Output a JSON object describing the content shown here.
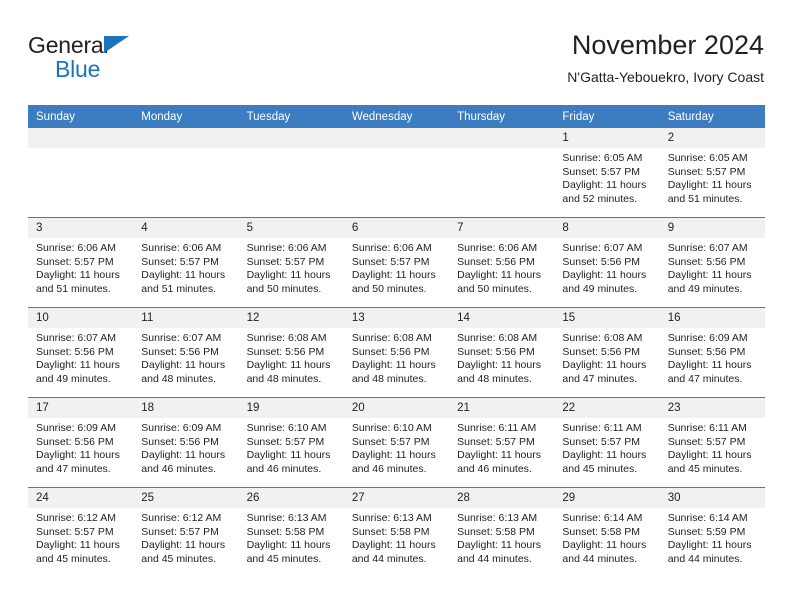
{
  "brand": {
    "name_top": "General",
    "name_bottom": "Blue",
    "flag_color": "#1b75bb"
  },
  "header": {
    "title": "November 2024",
    "subtitle": "N'Gatta-Yebouekro, Ivory Coast"
  },
  "theme": {
    "header_blue": "#3b7dc0",
    "daynum_bg": "#f1f1f1",
    "text": "#231f20"
  },
  "weekday_headers": [
    "Sunday",
    "Monday",
    "Tuesday",
    "Wednesday",
    "Thursday",
    "Friday",
    "Saturday"
  ],
  "weeks": [
    [
      {
        "day": "",
        "sunrise": "",
        "sunset": "",
        "daylight_1": "",
        "daylight_2": "",
        "empty": true
      },
      {
        "day": "",
        "sunrise": "",
        "sunset": "",
        "daylight_1": "",
        "daylight_2": "",
        "empty": true
      },
      {
        "day": "",
        "sunrise": "",
        "sunset": "",
        "daylight_1": "",
        "daylight_2": "",
        "empty": true
      },
      {
        "day": "",
        "sunrise": "",
        "sunset": "",
        "daylight_1": "",
        "daylight_2": "",
        "empty": true
      },
      {
        "day": "",
        "sunrise": "",
        "sunset": "",
        "daylight_1": "",
        "daylight_2": "",
        "empty": true
      },
      {
        "day": "1",
        "sunrise": "Sunrise: 6:05 AM",
        "sunset": "Sunset: 5:57 PM",
        "daylight_1": "Daylight: 11 hours",
        "daylight_2": "and 52 minutes."
      },
      {
        "day": "2",
        "sunrise": "Sunrise: 6:05 AM",
        "sunset": "Sunset: 5:57 PM",
        "daylight_1": "Daylight: 11 hours",
        "daylight_2": "and 51 minutes."
      }
    ],
    [
      {
        "day": "3",
        "sunrise": "Sunrise: 6:06 AM",
        "sunset": "Sunset: 5:57 PM",
        "daylight_1": "Daylight: 11 hours",
        "daylight_2": "and 51 minutes."
      },
      {
        "day": "4",
        "sunrise": "Sunrise: 6:06 AM",
        "sunset": "Sunset: 5:57 PM",
        "daylight_1": "Daylight: 11 hours",
        "daylight_2": "and 51 minutes."
      },
      {
        "day": "5",
        "sunrise": "Sunrise: 6:06 AM",
        "sunset": "Sunset: 5:57 PM",
        "daylight_1": "Daylight: 11 hours",
        "daylight_2": "and 50 minutes."
      },
      {
        "day": "6",
        "sunrise": "Sunrise: 6:06 AM",
        "sunset": "Sunset: 5:57 PM",
        "daylight_1": "Daylight: 11 hours",
        "daylight_2": "and 50 minutes."
      },
      {
        "day": "7",
        "sunrise": "Sunrise: 6:06 AM",
        "sunset": "Sunset: 5:56 PM",
        "daylight_1": "Daylight: 11 hours",
        "daylight_2": "and 50 minutes."
      },
      {
        "day": "8",
        "sunrise": "Sunrise: 6:07 AM",
        "sunset": "Sunset: 5:56 PM",
        "daylight_1": "Daylight: 11 hours",
        "daylight_2": "and 49 minutes."
      },
      {
        "day": "9",
        "sunrise": "Sunrise: 6:07 AM",
        "sunset": "Sunset: 5:56 PM",
        "daylight_1": "Daylight: 11 hours",
        "daylight_2": "and 49 minutes."
      }
    ],
    [
      {
        "day": "10",
        "sunrise": "Sunrise: 6:07 AM",
        "sunset": "Sunset: 5:56 PM",
        "daylight_1": "Daylight: 11 hours",
        "daylight_2": "and 49 minutes."
      },
      {
        "day": "11",
        "sunrise": "Sunrise: 6:07 AM",
        "sunset": "Sunset: 5:56 PM",
        "daylight_1": "Daylight: 11 hours",
        "daylight_2": "and 48 minutes."
      },
      {
        "day": "12",
        "sunrise": "Sunrise: 6:08 AM",
        "sunset": "Sunset: 5:56 PM",
        "daylight_1": "Daylight: 11 hours",
        "daylight_2": "and 48 minutes."
      },
      {
        "day": "13",
        "sunrise": "Sunrise: 6:08 AM",
        "sunset": "Sunset: 5:56 PM",
        "daylight_1": "Daylight: 11 hours",
        "daylight_2": "and 48 minutes."
      },
      {
        "day": "14",
        "sunrise": "Sunrise: 6:08 AM",
        "sunset": "Sunset: 5:56 PM",
        "daylight_1": "Daylight: 11 hours",
        "daylight_2": "and 48 minutes."
      },
      {
        "day": "15",
        "sunrise": "Sunrise: 6:08 AM",
        "sunset": "Sunset: 5:56 PM",
        "daylight_1": "Daylight: 11 hours",
        "daylight_2": "and 47 minutes."
      },
      {
        "day": "16",
        "sunrise": "Sunrise: 6:09 AM",
        "sunset": "Sunset: 5:56 PM",
        "daylight_1": "Daylight: 11 hours",
        "daylight_2": "and 47 minutes."
      }
    ],
    [
      {
        "day": "17",
        "sunrise": "Sunrise: 6:09 AM",
        "sunset": "Sunset: 5:56 PM",
        "daylight_1": "Daylight: 11 hours",
        "daylight_2": "and 47 minutes."
      },
      {
        "day": "18",
        "sunrise": "Sunrise: 6:09 AM",
        "sunset": "Sunset: 5:56 PM",
        "daylight_1": "Daylight: 11 hours",
        "daylight_2": "and 46 minutes."
      },
      {
        "day": "19",
        "sunrise": "Sunrise: 6:10 AM",
        "sunset": "Sunset: 5:57 PM",
        "daylight_1": "Daylight: 11 hours",
        "daylight_2": "and 46 minutes."
      },
      {
        "day": "20",
        "sunrise": "Sunrise: 6:10 AM",
        "sunset": "Sunset: 5:57 PM",
        "daylight_1": "Daylight: 11 hours",
        "daylight_2": "and 46 minutes."
      },
      {
        "day": "21",
        "sunrise": "Sunrise: 6:11 AM",
        "sunset": "Sunset: 5:57 PM",
        "daylight_1": "Daylight: 11 hours",
        "daylight_2": "and 46 minutes."
      },
      {
        "day": "22",
        "sunrise": "Sunrise: 6:11 AM",
        "sunset": "Sunset: 5:57 PM",
        "daylight_1": "Daylight: 11 hours",
        "daylight_2": "and 45 minutes."
      },
      {
        "day": "23",
        "sunrise": "Sunrise: 6:11 AM",
        "sunset": "Sunset: 5:57 PM",
        "daylight_1": "Daylight: 11 hours",
        "daylight_2": "and 45 minutes."
      }
    ],
    [
      {
        "day": "24",
        "sunrise": "Sunrise: 6:12 AM",
        "sunset": "Sunset: 5:57 PM",
        "daylight_1": "Daylight: 11 hours",
        "daylight_2": "and 45 minutes."
      },
      {
        "day": "25",
        "sunrise": "Sunrise: 6:12 AM",
        "sunset": "Sunset: 5:57 PM",
        "daylight_1": "Daylight: 11 hours",
        "daylight_2": "and 45 minutes."
      },
      {
        "day": "26",
        "sunrise": "Sunrise: 6:13 AM",
        "sunset": "Sunset: 5:58 PM",
        "daylight_1": "Daylight: 11 hours",
        "daylight_2": "and 45 minutes."
      },
      {
        "day": "27",
        "sunrise": "Sunrise: 6:13 AM",
        "sunset": "Sunset: 5:58 PM",
        "daylight_1": "Daylight: 11 hours",
        "daylight_2": "and 44 minutes."
      },
      {
        "day": "28",
        "sunrise": "Sunrise: 6:13 AM",
        "sunset": "Sunset: 5:58 PM",
        "daylight_1": "Daylight: 11 hours",
        "daylight_2": "and 44 minutes."
      },
      {
        "day": "29",
        "sunrise": "Sunrise: 6:14 AM",
        "sunset": "Sunset: 5:58 PM",
        "daylight_1": "Daylight: 11 hours",
        "daylight_2": "and 44 minutes."
      },
      {
        "day": "30",
        "sunrise": "Sunrise: 6:14 AM",
        "sunset": "Sunset: 5:59 PM",
        "daylight_1": "Daylight: 11 hours",
        "daylight_2": "and 44 minutes."
      }
    ]
  ]
}
